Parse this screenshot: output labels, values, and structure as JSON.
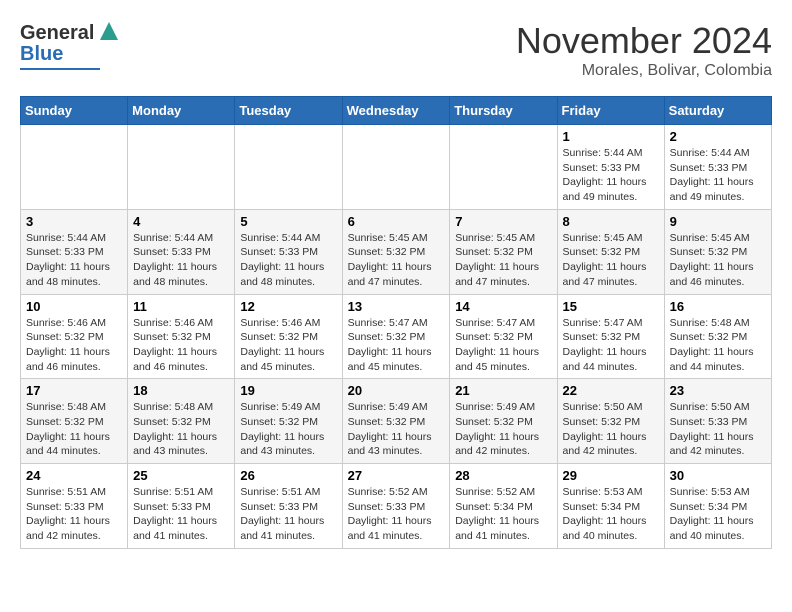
{
  "header": {
    "logo_general": "General",
    "logo_blue": "Blue",
    "month_title": "November 2024",
    "location": "Morales, Bolivar, Colombia"
  },
  "days_of_week": [
    "Sunday",
    "Monday",
    "Tuesday",
    "Wednesday",
    "Thursday",
    "Friday",
    "Saturday"
  ],
  "weeks": [
    [
      {
        "day": "",
        "info": ""
      },
      {
        "day": "",
        "info": ""
      },
      {
        "day": "",
        "info": ""
      },
      {
        "day": "",
        "info": ""
      },
      {
        "day": "",
        "info": ""
      },
      {
        "day": "1",
        "info": "Sunrise: 5:44 AM\nSunset: 5:33 PM\nDaylight: 11 hours\nand 49 minutes."
      },
      {
        "day": "2",
        "info": "Sunrise: 5:44 AM\nSunset: 5:33 PM\nDaylight: 11 hours\nand 49 minutes."
      }
    ],
    [
      {
        "day": "3",
        "info": "Sunrise: 5:44 AM\nSunset: 5:33 PM\nDaylight: 11 hours\nand 48 minutes."
      },
      {
        "day": "4",
        "info": "Sunrise: 5:44 AM\nSunset: 5:33 PM\nDaylight: 11 hours\nand 48 minutes."
      },
      {
        "day": "5",
        "info": "Sunrise: 5:44 AM\nSunset: 5:33 PM\nDaylight: 11 hours\nand 48 minutes."
      },
      {
        "day": "6",
        "info": "Sunrise: 5:45 AM\nSunset: 5:32 PM\nDaylight: 11 hours\nand 47 minutes."
      },
      {
        "day": "7",
        "info": "Sunrise: 5:45 AM\nSunset: 5:32 PM\nDaylight: 11 hours\nand 47 minutes."
      },
      {
        "day": "8",
        "info": "Sunrise: 5:45 AM\nSunset: 5:32 PM\nDaylight: 11 hours\nand 47 minutes."
      },
      {
        "day": "9",
        "info": "Sunrise: 5:45 AM\nSunset: 5:32 PM\nDaylight: 11 hours\nand 46 minutes."
      }
    ],
    [
      {
        "day": "10",
        "info": "Sunrise: 5:46 AM\nSunset: 5:32 PM\nDaylight: 11 hours\nand 46 minutes."
      },
      {
        "day": "11",
        "info": "Sunrise: 5:46 AM\nSunset: 5:32 PM\nDaylight: 11 hours\nand 46 minutes."
      },
      {
        "day": "12",
        "info": "Sunrise: 5:46 AM\nSunset: 5:32 PM\nDaylight: 11 hours\nand 45 minutes."
      },
      {
        "day": "13",
        "info": "Sunrise: 5:47 AM\nSunset: 5:32 PM\nDaylight: 11 hours\nand 45 minutes."
      },
      {
        "day": "14",
        "info": "Sunrise: 5:47 AM\nSunset: 5:32 PM\nDaylight: 11 hours\nand 45 minutes."
      },
      {
        "day": "15",
        "info": "Sunrise: 5:47 AM\nSunset: 5:32 PM\nDaylight: 11 hours\nand 44 minutes."
      },
      {
        "day": "16",
        "info": "Sunrise: 5:48 AM\nSunset: 5:32 PM\nDaylight: 11 hours\nand 44 minutes."
      }
    ],
    [
      {
        "day": "17",
        "info": "Sunrise: 5:48 AM\nSunset: 5:32 PM\nDaylight: 11 hours\nand 44 minutes."
      },
      {
        "day": "18",
        "info": "Sunrise: 5:48 AM\nSunset: 5:32 PM\nDaylight: 11 hours\nand 43 minutes."
      },
      {
        "day": "19",
        "info": "Sunrise: 5:49 AM\nSunset: 5:32 PM\nDaylight: 11 hours\nand 43 minutes."
      },
      {
        "day": "20",
        "info": "Sunrise: 5:49 AM\nSunset: 5:32 PM\nDaylight: 11 hours\nand 43 minutes."
      },
      {
        "day": "21",
        "info": "Sunrise: 5:49 AM\nSunset: 5:32 PM\nDaylight: 11 hours\nand 42 minutes."
      },
      {
        "day": "22",
        "info": "Sunrise: 5:50 AM\nSunset: 5:32 PM\nDaylight: 11 hours\nand 42 minutes."
      },
      {
        "day": "23",
        "info": "Sunrise: 5:50 AM\nSunset: 5:33 PM\nDaylight: 11 hours\nand 42 minutes."
      }
    ],
    [
      {
        "day": "24",
        "info": "Sunrise: 5:51 AM\nSunset: 5:33 PM\nDaylight: 11 hours\nand 42 minutes."
      },
      {
        "day": "25",
        "info": "Sunrise: 5:51 AM\nSunset: 5:33 PM\nDaylight: 11 hours\nand 41 minutes."
      },
      {
        "day": "26",
        "info": "Sunrise: 5:51 AM\nSunset: 5:33 PM\nDaylight: 11 hours\nand 41 minutes."
      },
      {
        "day": "27",
        "info": "Sunrise: 5:52 AM\nSunset: 5:33 PM\nDaylight: 11 hours\nand 41 minutes."
      },
      {
        "day": "28",
        "info": "Sunrise: 5:52 AM\nSunset: 5:34 PM\nDaylight: 11 hours\nand 41 minutes."
      },
      {
        "day": "29",
        "info": "Sunrise: 5:53 AM\nSunset: 5:34 PM\nDaylight: 11 hours\nand 40 minutes."
      },
      {
        "day": "30",
        "info": "Sunrise: 5:53 AM\nSunset: 5:34 PM\nDaylight: 11 hours\nand 40 minutes."
      }
    ]
  ]
}
